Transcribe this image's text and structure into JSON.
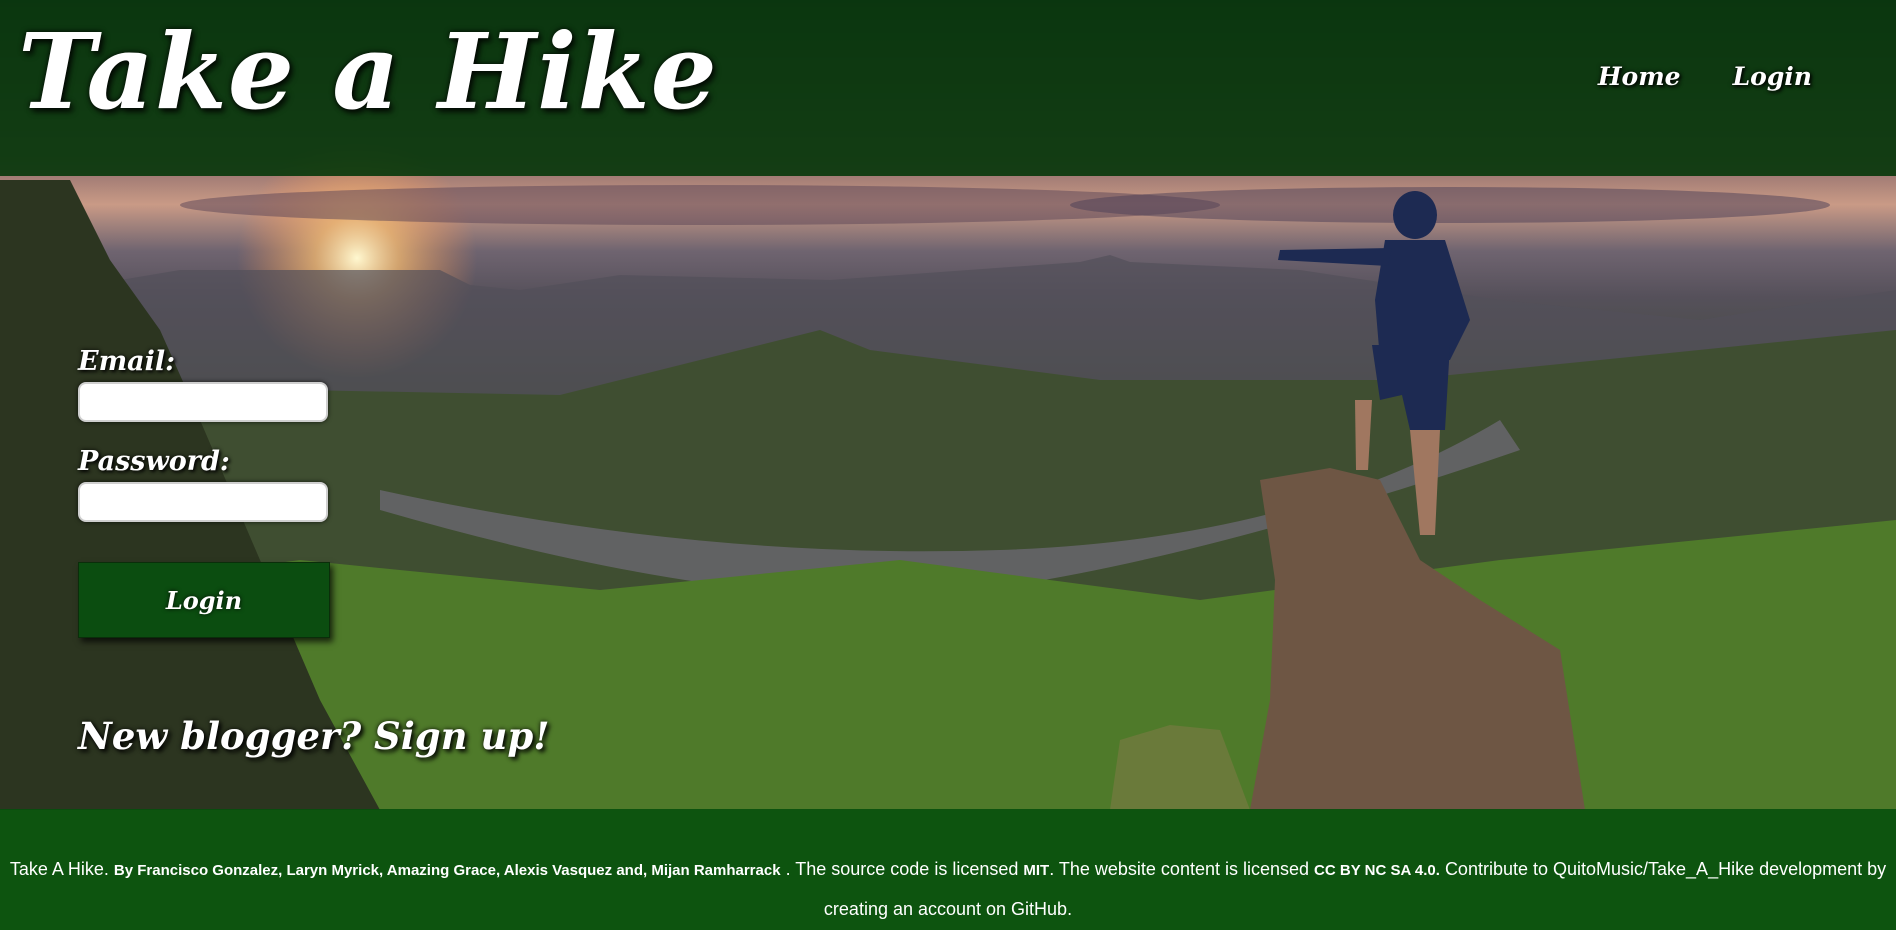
{
  "header": {
    "brand": "Take a Hike",
    "nav": {
      "home": "Home",
      "login": "Login"
    }
  },
  "login_form": {
    "email_label": "Email:",
    "email_value": "",
    "password_label": "Password:",
    "password_value": "",
    "submit_label": "Login",
    "signup_link": "New blogger? Sign up!"
  },
  "footer": {
    "site_name": "Take A Hike.",
    "authors": "By Francisco Gonzalez, Laryn Myrick, Amazing Grace, Alexis Vasquez and, Mijan Ramharrack",
    "license_text": ". The source code is licensed",
    "code_license": "MIT",
    "content_text": ". The website content is licensed",
    "content_license": "CC BY NC SA 4.0.",
    "contribute_text": "Contribute to QuitoMusic/Take_A_Hike development by creating an account on GitHub."
  },
  "colors": {
    "header_bg": "#05370a",
    "footer_bg": "#05500c",
    "button_bg": "#0b4d10",
    "text": "#ffffff"
  }
}
